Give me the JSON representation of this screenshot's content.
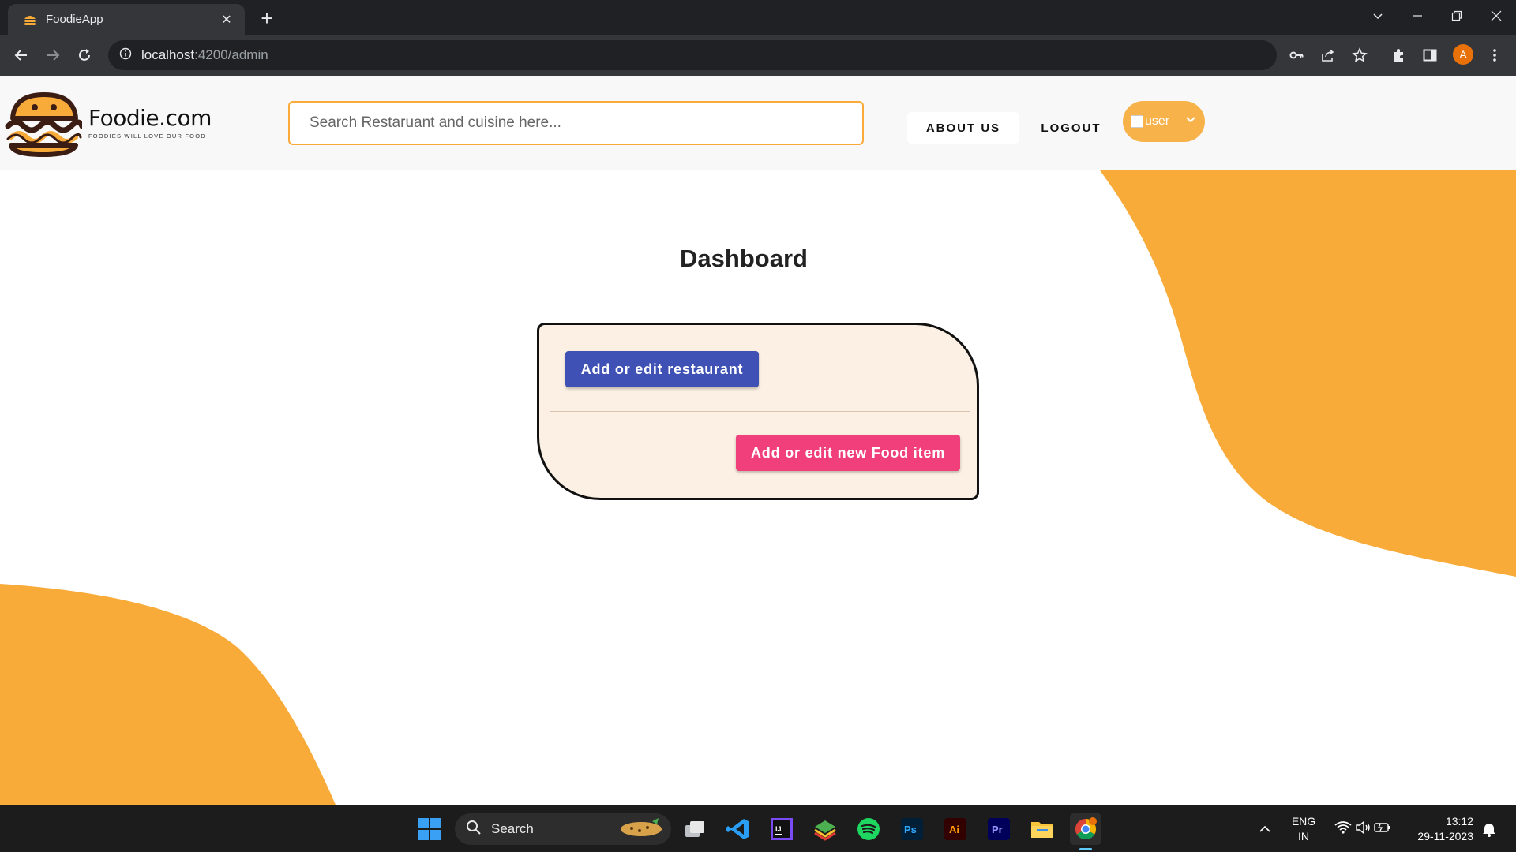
{
  "browser": {
    "tab_title": "FoodieApp",
    "tab_close": "✕",
    "new_tab": "+",
    "url_host": "localhost",
    "url_path": ":4200/admin",
    "profile_initial": "A"
  },
  "header": {
    "logo_name": "Foodie.com",
    "logo_tagline": "FOODIES WILL LOVE OUR FOOD",
    "search_placeholder": "Search Restaruant and cuisine here...",
    "about_label": "ABOUT US",
    "logout_label": "LOGOUT",
    "user_alt": "user"
  },
  "main": {
    "title": "Dashboard",
    "restaurant_button": "Add or edit restaurant",
    "food_button": "Add or edit new Food item"
  },
  "taskbar": {
    "search_label": "Search",
    "lang_primary": "ENG",
    "lang_secondary": "IN",
    "time": "13:12",
    "date": "29-11-2023"
  },
  "colors": {
    "accent_orange": "#f9ab3a",
    "restaurant_button": "#3f51b5",
    "food_button": "#f03f7a",
    "card_bg": "#fbf0e3"
  }
}
